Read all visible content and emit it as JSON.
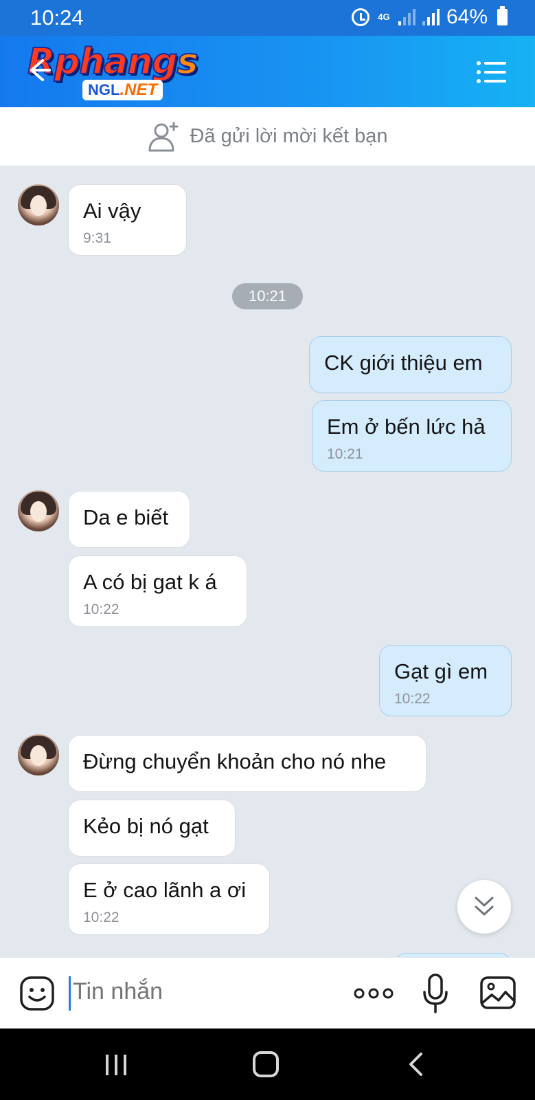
{
  "status_bar": {
    "time": "10:24",
    "network": "4G",
    "battery": "64%"
  },
  "header": {
    "logo_text_main": "Rphang",
    "logo_text_end": "s",
    "logo_badge_left": "NGL",
    "logo_badge_right": ".NET"
  },
  "friend_bar": {
    "label": "Đã gửi lời mời kết bạn"
  },
  "messages": [
    {
      "from": "other",
      "text": "Ai vậy",
      "time": "9:31"
    },
    {
      "divider": "10:21"
    },
    {
      "from": "me",
      "text": "CK giới thiệu em",
      "time": ""
    },
    {
      "from": "me",
      "text": "Em ở bến lức hả",
      "time": "10:21"
    },
    {
      "from": "other",
      "text": "Da e biết",
      "time": ""
    },
    {
      "from": "other",
      "text": "A có bị gat k á",
      "time": "10:22"
    },
    {
      "from": "me",
      "text": "Gạt gì em",
      "time": "10:22"
    },
    {
      "from": "other",
      "text": "Đừng chuyển khoản cho nó nhe",
      "time": ""
    },
    {
      "from": "other",
      "text": "Kẻo bị nó gạt",
      "time": ""
    },
    {
      "from": "other",
      "text": "E ở cao lãnh a ơi",
      "time": "10:22"
    }
  ],
  "input_bar": {
    "placeholder": "Tin nhắn"
  },
  "icons": {
    "back": "arrow-left-icon",
    "menu": "list-menu-icon",
    "add_user": "add-user-icon",
    "emoji": "smiley-icon",
    "more": "more-dots-icon",
    "mic": "microphone-icon",
    "image": "image-icon",
    "scroll_down": "double-chevron-down-icon"
  },
  "colors": {
    "header_start": "#1479ee",
    "header_end": "#16b2f4",
    "bubble_out": "#d5ecfd",
    "bubble_in": "#ffffff",
    "chat_bg": "#e3e8ef"
  }
}
